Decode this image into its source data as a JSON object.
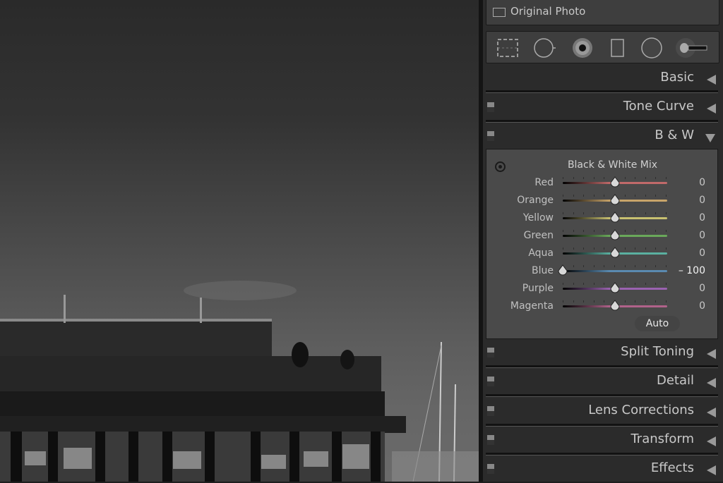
{
  "photo": {
    "description": "black and white harbor scene with pier building and sailboat masts"
  },
  "panel": {
    "original_photo_label": "Original Photo",
    "tools": [
      {
        "name": "crop-overlay-tool"
      },
      {
        "name": "spot-removal-tool"
      },
      {
        "name": "red-eye-tool"
      },
      {
        "name": "graduated-filter-tool"
      },
      {
        "name": "radial-filter-tool"
      },
      {
        "name": "adjustment-brush-tool"
      }
    ],
    "sections_top": [
      {
        "label": "Basic",
        "has_switch": false,
        "expanded": false
      },
      {
        "label": "Tone Curve",
        "has_switch": true,
        "expanded": false
      },
      {
        "label": "B & W",
        "has_switch": true,
        "expanded": true
      }
    ],
    "bw_mix": {
      "title": "Black & White Mix",
      "range": [
        -100,
        100
      ],
      "channels": [
        {
          "label": "Red",
          "value": 0,
          "display": "0",
          "color": "#c06a6a"
        },
        {
          "label": "Orange",
          "value": 0,
          "display": "0",
          "color": "#c8a46a"
        },
        {
          "label": "Yellow",
          "value": 0,
          "display": "0",
          "color": "#c8c070"
        },
        {
          "label": "Green",
          "value": 0,
          "display": "0",
          "color": "#6aa85a"
        },
        {
          "label": "Aqua",
          "value": 0,
          "display": "0",
          "color": "#5ab0a0"
        },
        {
          "label": "Blue",
          "value": -100,
          "display": "– 100",
          "color": "#5a8ab0"
        },
        {
          "label": "Purple",
          "value": 0,
          "display": "0",
          "color": "#9a62b0"
        },
        {
          "label": "Magenta",
          "value": 0,
          "display": "0",
          "color": "#b0628a"
        }
      ],
      "auto_label": "Auto"
    },
    "sections_bottom": [
      {
        "label": "Split Toning",
        "has_switch": true,
        "expanded": false
      },
      {
        "label": "Detail",
        "has_switch": true,
        "expanded": false
      },
      {
        "label": "Lens Corrections",
        "has_switch": true,
        "expanded": false
      },
      {
        "label": "Transform",
        "has_switch": true,
        "expanded": false
      },
      {
        "label": "Effects",
        "has_switch": true,
        "expanded": false
      }
    ]
  }
}
